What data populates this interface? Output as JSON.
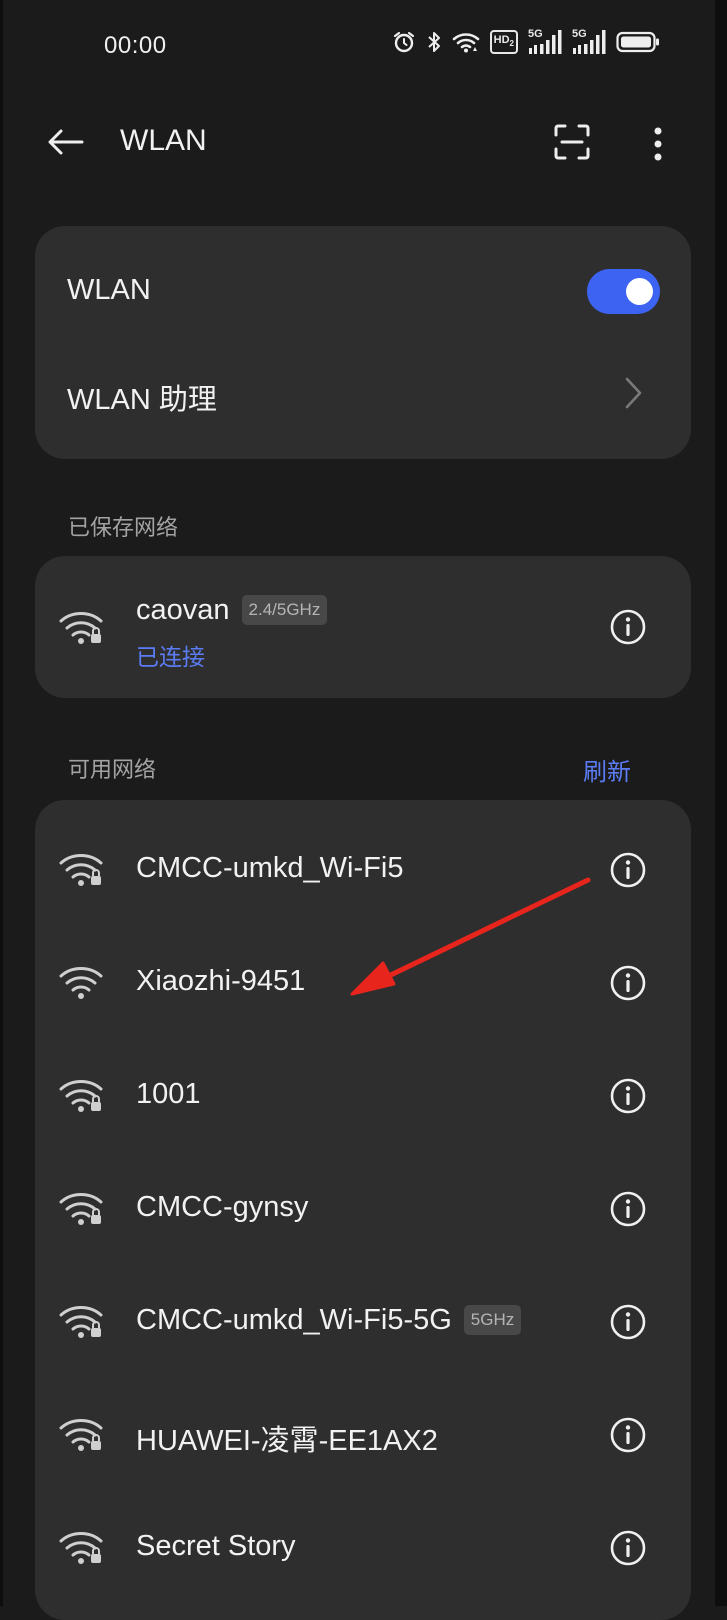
{
  "status_bar": {
    "time": "00:00",
    "icons": [
      "alarm-icon",
      "bluetooth-icon",
      "wifi-icon",
      "hd-voice-icon",
      "5g-signal-icon",
      "5g-signal-icon",
      "battery-icon"
    ],
    "hd_label": "HD",
    "hd_sub": "2",
    "fiveg_label": "5G"
  },
  "header": {
    "title": "WLAN",
    "icons": [
      "back-arrow-icon",
      "scan-icon",
      "more-vertical-icon"
    ]
  },
  "wlan_card": {
    "wlan_label": "WLAN",
    "wlan_enabled": true,
    "assistant_label": "WLAN 助理"
  },
  "saved_section": {
    "label": "已保存网络",
    "networks": [
      {
        "name": "caovan",
        "band": "2.4/5GHz",
        "status": "已连接",
        "secured": true
      }
    ]
  },
  "available_section": {
    "label": "可用网络",
    "refresh_label": "刷新",
    "networks": [
      {
        "name": "CMCC-umkd_Wi-Fi5",
        "band": "",
        "secured": true
      },
      {
        "name": "Xiaozhi-9451",
        "band": "",
        "secured": false
      },
      {
        "name": "1001",
        "band": "",
        "secured": true
      },
      {
        "name": "CMCC-gynsy",
        "band": "",
        "secured": true
      },
      {
        "name": "CMCC-umkd_Wi-Fi5-5G",
        "band": "5GHz",
        "secured": true
      },
      {
        "name": "HUAWEI-凌霄-EE1AX2",
        "band": "",
        "secured": true
      },
      {
        "name": "Secret Story",
        "band": "",
        "secured": true
      }
    ]
  },
  "annotation": {
    "type": "red-arrow",
    "target": "Xiaozhi-9451",
    "color": "#e8251d"
  },
  "colors": {
    "background": "#1b1b1b",
    "card": "#2e2e2e",
    "accent": "#3d63f2",
    "link": "#5b7cf5",
    "annotation": "#e8251d"
  }
}
